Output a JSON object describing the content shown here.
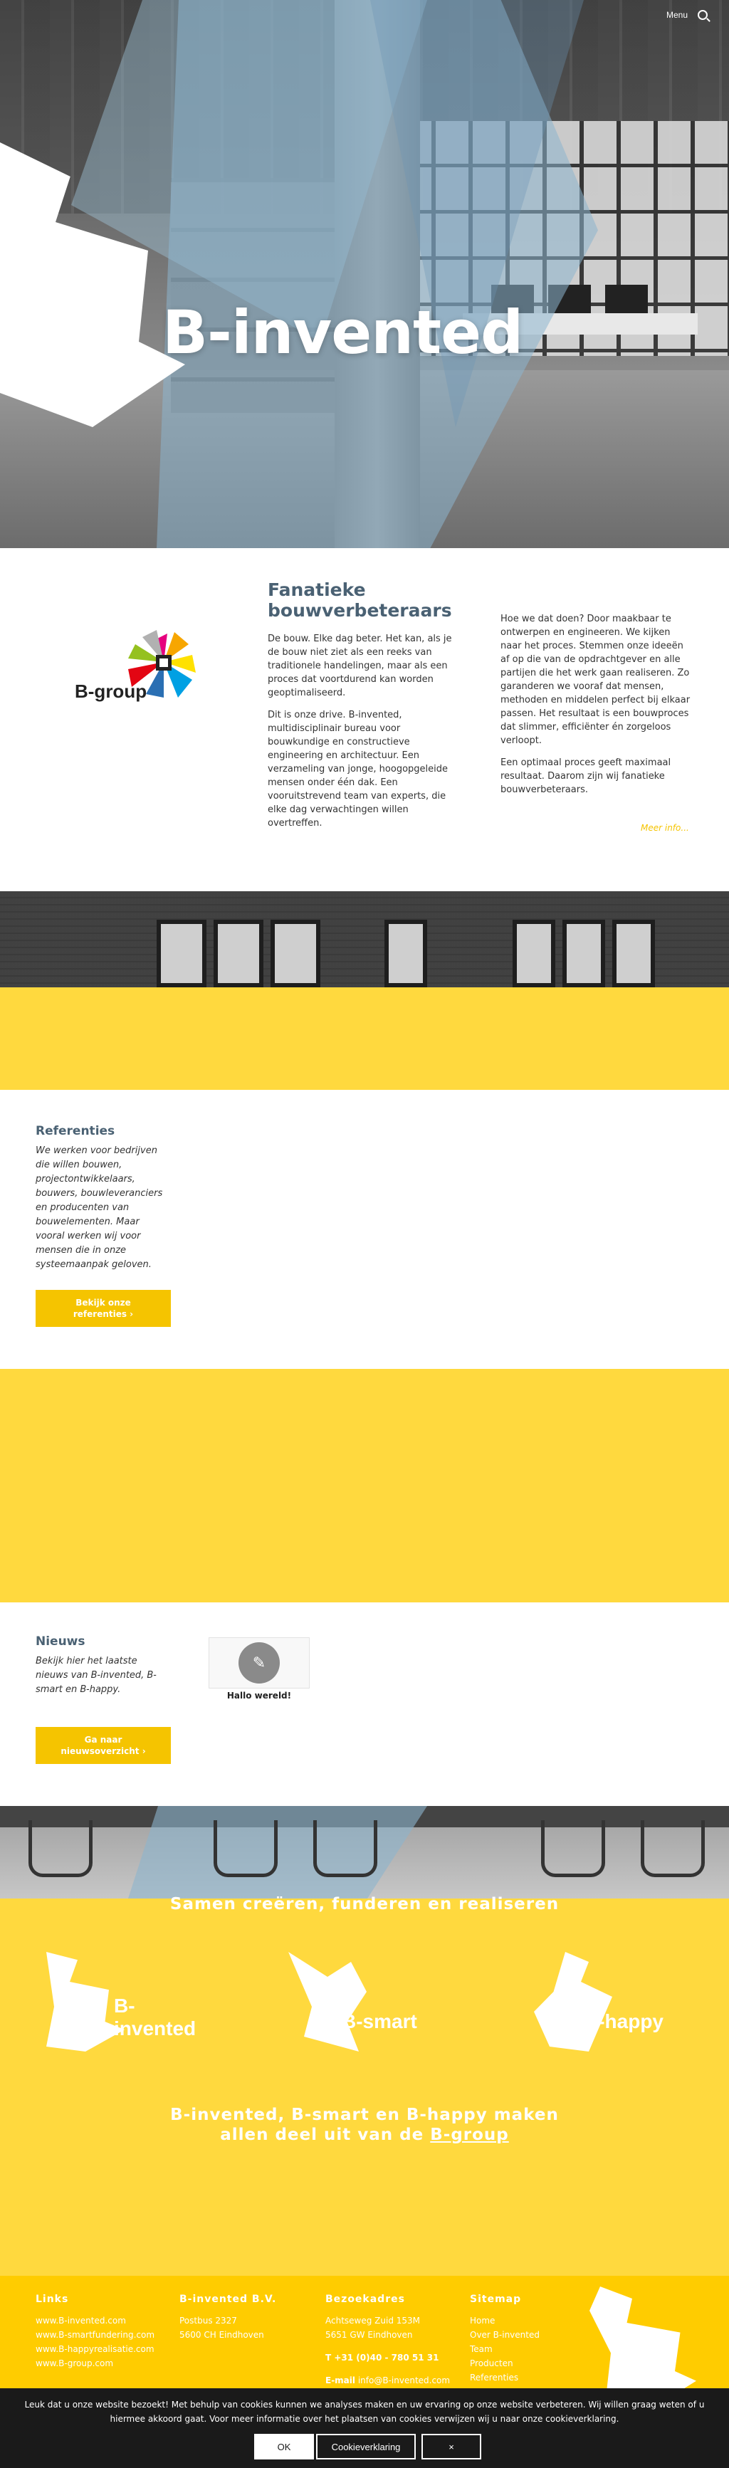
{
  "nav": {
    "menu_label": "Menu",
    "search_icon": "search-icon"
  },
  "hero": {
    "title": "B-invented"
  },
  "intro": {
    "logo_text": "B-group",
    "heading": "Fanatieke bouwverbeteraars",
    "col1": [
      "De bouw. Elke dag beter. Het kan, als je de bouw niet ziet als een reeks van traditionele handelingen, maar als een proces dat voortdurend kan worden geoptimaliseerd.",
      "Dit is onze drive. B-invented, multidisciplinair bureau voor bouwkundige en constructieve engineering en architectuur. Een verzameling van jonge, hoogopgeleide mensen onder één dak. Een vooruitstrevend team van experts, die elke dag verwachtingen willen overtreffen."
    ],
    "col2": [
      "Hoe we dat doen? Door maakbaar te ontwerpen en engineeren. We kijken naar het proces. Stemmen onze ideeën af op die van de opdrachtgever en alle partijen die het werk gaan realiseren. Zo garanderen we vooraf dat mensen, methoden en middelen perfect bij elkaar passen. Het resultaat is een bouwproces dat slimmer, efficiënter én zorgeloos verloopt.",
      "Een optimaal proces geeft maximaal resultaat. Daarom zijn wij fanatieke bouwverbeteraars."
    ],
    "more_link": "Meer info..."
  },
  "refs": {
    "title": "Referenties",
    "text": "We werken voor bedrijven die willen bouwen, projectontwikkelaars, bouwers, bouwleveranciers en producenten van bouwelementen. Maar vooral werken wij voor mensen die in onze systeemaanpak geloven.",
    "button": "Bekijk onze referenties ›"
  },
  "news": {
    "title": "Nieuws",
    "text": "Bekijk hier het laatste nieuws van B-invented, B-smart en B-happy.",
    "button": "Ga naar nieuwsoverzicht ›",
    "card_title": "Hallo wereld!"
  },
  "brands": {
    "slogan": "Samen creëren, funderen en realiseren",
    "items": [
      "B-invented",
      "B-smart",
      "B-happy"
    ],
    "sub_line1": "B-invented, B-smart en B-happy maken",
    "sub_line2_pre": "allen deel uit van de ",
    "sub_line2_link": "B-group"
  },
  "footer": {
    "links": {
      "title": "Links",
      "items": [
        "www.B-invented.com",
        "www.B-smartfundering.com",
        "www.B-happyrealisatie.com",
        "www.B-group.com"
      ]
    },
    "company": {
      "title": "B-invented B.V.",
      "lines": [
        "Postbus 2327",
        "5600 CH Eindhoven"
      ]
    },
    "visit": {
      "title": "Bezoekadres",
      "lines": [
        "Achtseweg Zuid 153M",
        "5651 GW Eindhoven"
      ],
      "phone": "T +31 (0)40 - 780 51 31",
      "email_label": "E-mail",
      "email": "info@B-invented.com"
    },
    "sitemap": {
      "title": "Sitemap",
      "items": [
        "Home",
        "Over B-invented",
        "Team",
        "Producten",
        "Referenties"
      ]
    }
  },
  "cookie": {
    "message": "Leuk dat u onze website bezoekt! Met behulp van cookies kunnen we analyses maken en uw ervaring op onze website verbeteren. Wij willen graag weten of u hiermee akkoord gaat. Voor meer informatie over het plaatsen van cookies verwijzen wij u naar onze cookieverklaring.",
    "ok": "OK",
    "statement": "Cookieverklaring",
    "close": "×"
  },
  "colors": {
    "yellow": "#ffd93e",
    "button_yellow": "#f5c400",
    "heading_blue": "#4a6173",
    "footer_yellow": "#ffcc00"
  }
}
